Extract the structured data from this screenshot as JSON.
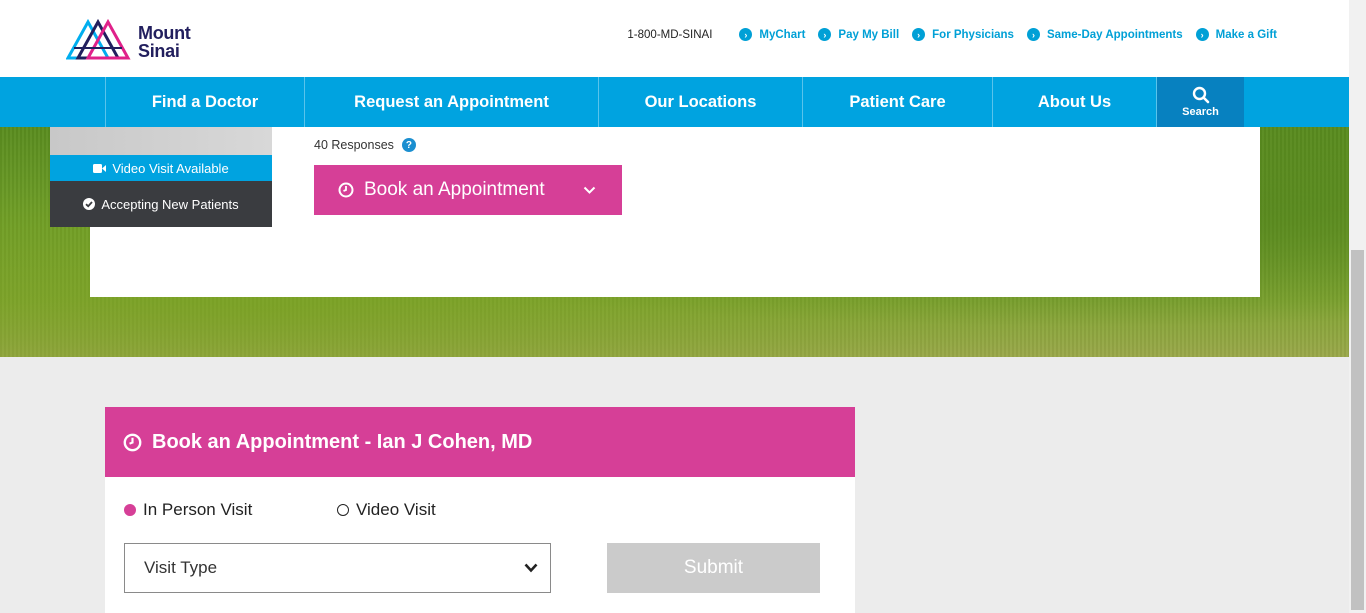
{
  "logo": {
    "text_line1": "Mount",
    "text_line2": "Sinai"
  },
  "utility": {
    "phone": "1-800-MD-SINAI",
    "links": [
      "MyChart",
      "Pay My Bill",
      "For Physicians",
      "Same-Day Appointments",
      "Make a Gift"
    ]
  },
  "nav": {
    "items": [
      "Find a Doctor",
      "Request an Appointment",
      "Our Locations",
      "Patient Care",
      "About Us"
    ],
    "search_label": "Search"
  },
  "profile": {
    "video_tag": "Video Visit Available",
    "accepting_tag": "Accepting New Patients",
    "responses": "40 Responses",
    "help_mark": "?",
    "book_button": "Book an Appointment"
  },
  "booking": {
    "title": "Book an Appointment - Ian J Cohen, MD",
    "option_in_person": "In Person Visit",
    "option_video": "Video Visit",
    "visit_type_placeholder": "Visit Type",
    "submit_label": "Submit"
  },
  "colors": {
    "brand_blue": "#00a3e0",
    "brand_pink": "#d63f97",
    "dark_tag": "#3a3c40"
  }
}
